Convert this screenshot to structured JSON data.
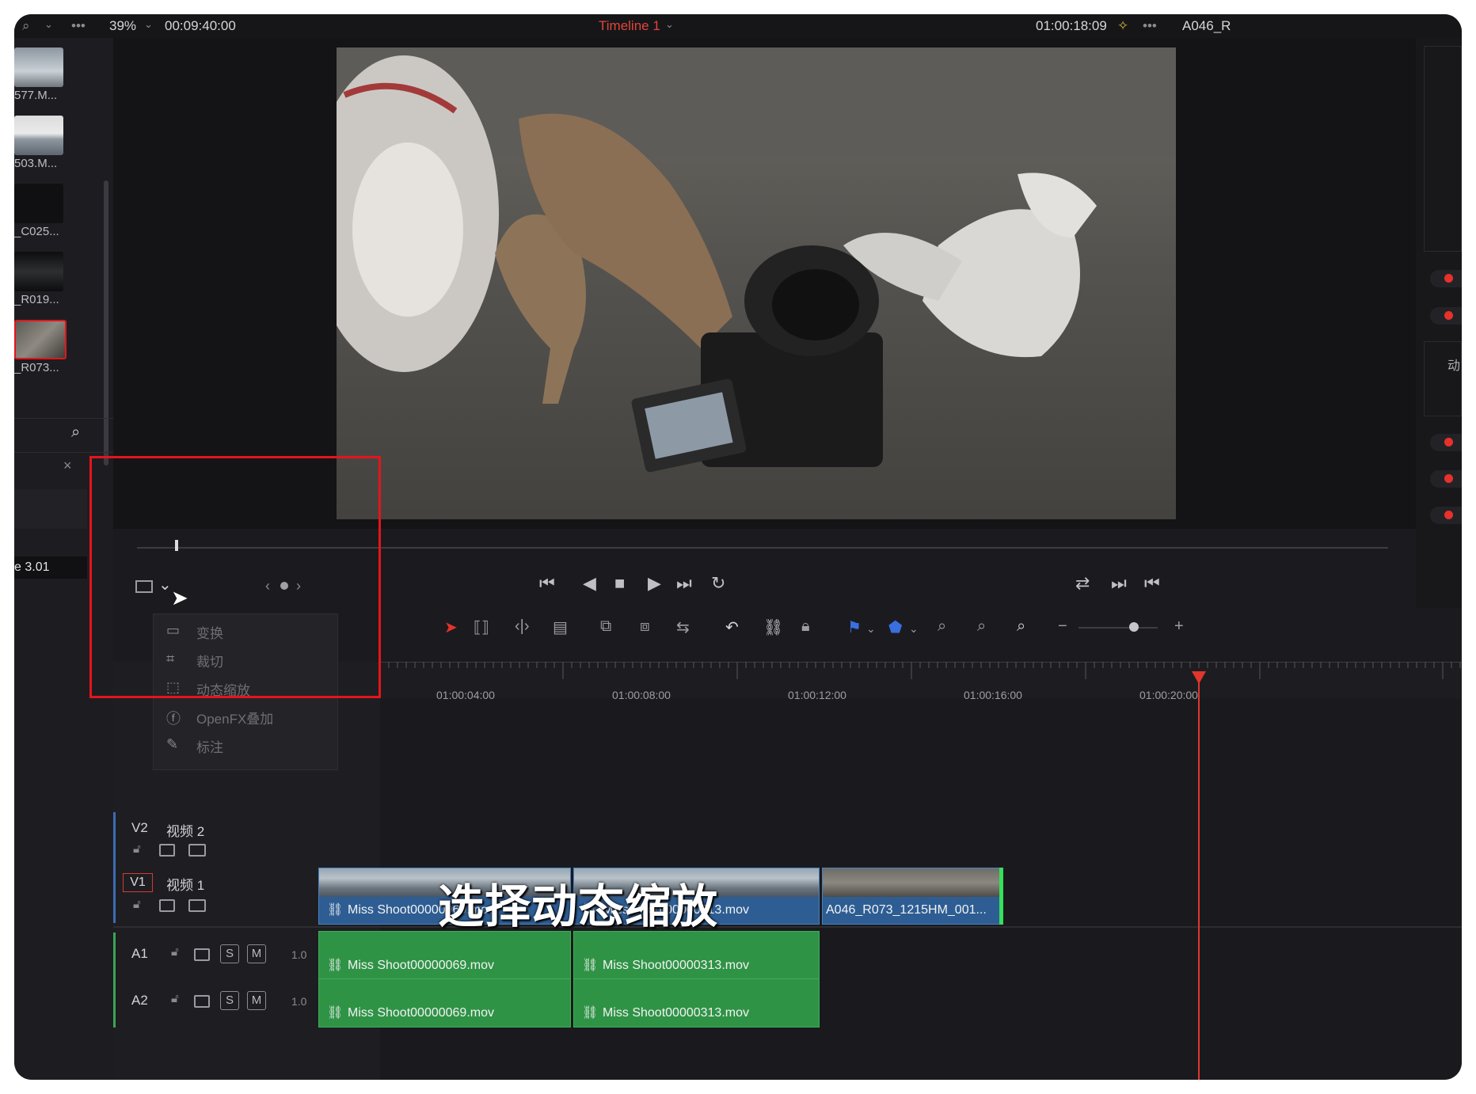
{
  "topbar": {
    "zoom": "39%",
    "duration": "00:09:40:00",
    "timeline_name": "Timeline 1",
    "current_timecode": "01:00:18:09",
    "clip_name": "A046_R"
  },
  "media_pool": {
    "clips": [
      {
        "label": "577.M..."
      },
      {
        "label": "503.M..."
      },
      {
        "label": "_C025..."
      },
      {
        "label": "_R019..."
      },
      {
        "label": "_R073..."
      }
    ],
    "version_label": "e 3.01"
  },
  "menu": {
    "items": [
      {
        "label": "变换",
        "icon": "transform-icon"
      },
      {
        "label": "裁切",
        "icon": "crop-icon"
      },
      {
        "label": "动态缩放",
        "icon": "dynamic-zoom-icon"
      },
      {
        "label": "OpenFX叠加",
        "icon": "openfx-icon"
      },
      {
        "label": "标注",
        "icon": "annotation-icon"
      }
    ]
  },
  "ruler": {
    "ticks": [
      "01:00:04:00",
      "01:00:08:00",
      "01:00:12:00",
      "01:00:16:00",
      "01:00:20:00"
    ]
  },
  "tracks": {
    "v2": {
      "id": "V2",
      "name": "视频 2"
    },
    "v1": {
      "id": "V1",
      "name": "视频 1"
    },
    "a1": {
      "id": "A1",
      "level": "1.0",
      "solo": "S",
      "mute": "M"
    },
    "a2": {
      "id": "A2",
      "level": "1.0",
      "solo": "S",
      "mute": "M"
    }
  },
  "clips": {
    "v1": [
      "Miss Shoot00000069.mov",
      "Miss Shoot00000313.mov",
      "A046_R073_1215HM_001..."
    ],
    "a1": [
      "Miss Shoot00000069.mov",
      "Miss Shoot00000313.mov"
    ],
    "a2": [
      "Miss Shoot00000069.mov",
      "Miss Shoot00000313.mov"
    ]
  },
  "right_panel": {
    "labels": [
      "动"
    ]
  },
  "caption": "选择动态缩放",
  "colors": {
    "accent_red": "#e5141b",
    "video_clip": "#2d5d93",
    "audio_clip": "#2f9346",
    "timeline_title": "#e0453a"
  }
}
